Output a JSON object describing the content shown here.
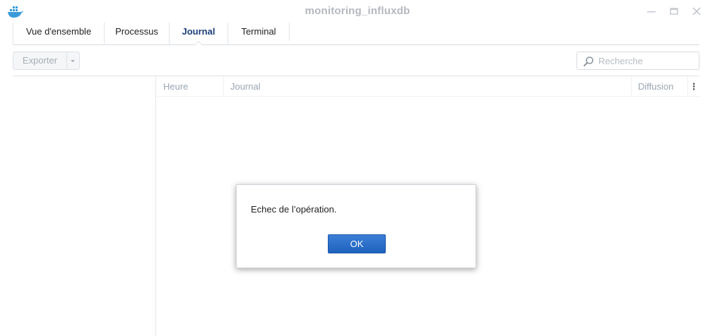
{
  "window": {
    "title": "monitoring_influxdb",
    "app_icon": "docker-whale-icon"
  },
  "tabs": [
    {
      "label": "Vue d'ensemble",
      "active": false
    },
    {
      "label": "Processus",
      "active": false
    },
    {
      "label": "Journal",
      "active": true
    },
    {
      "label": "Terminal",
      "active": false
    }
  ],
  "toolbar": {
    "export_label": "Exporter",
    "search_placeholder": "Recherche"
  },
  "grid": {
    "columns": [
      "Heure",
      "Journal",
      "Diffusion"
    ],
    "menu_glyph": "⋮"
  },
  "dialog": {
    "message": "Echec de l’opération.",
    "ok_label": "OK"
  },
  "colors": {
    "accent": "#2a6dcc",
    "active_tab": "#1c3f7a",
    "muted_text": "#9aa6b3"
  }
}
